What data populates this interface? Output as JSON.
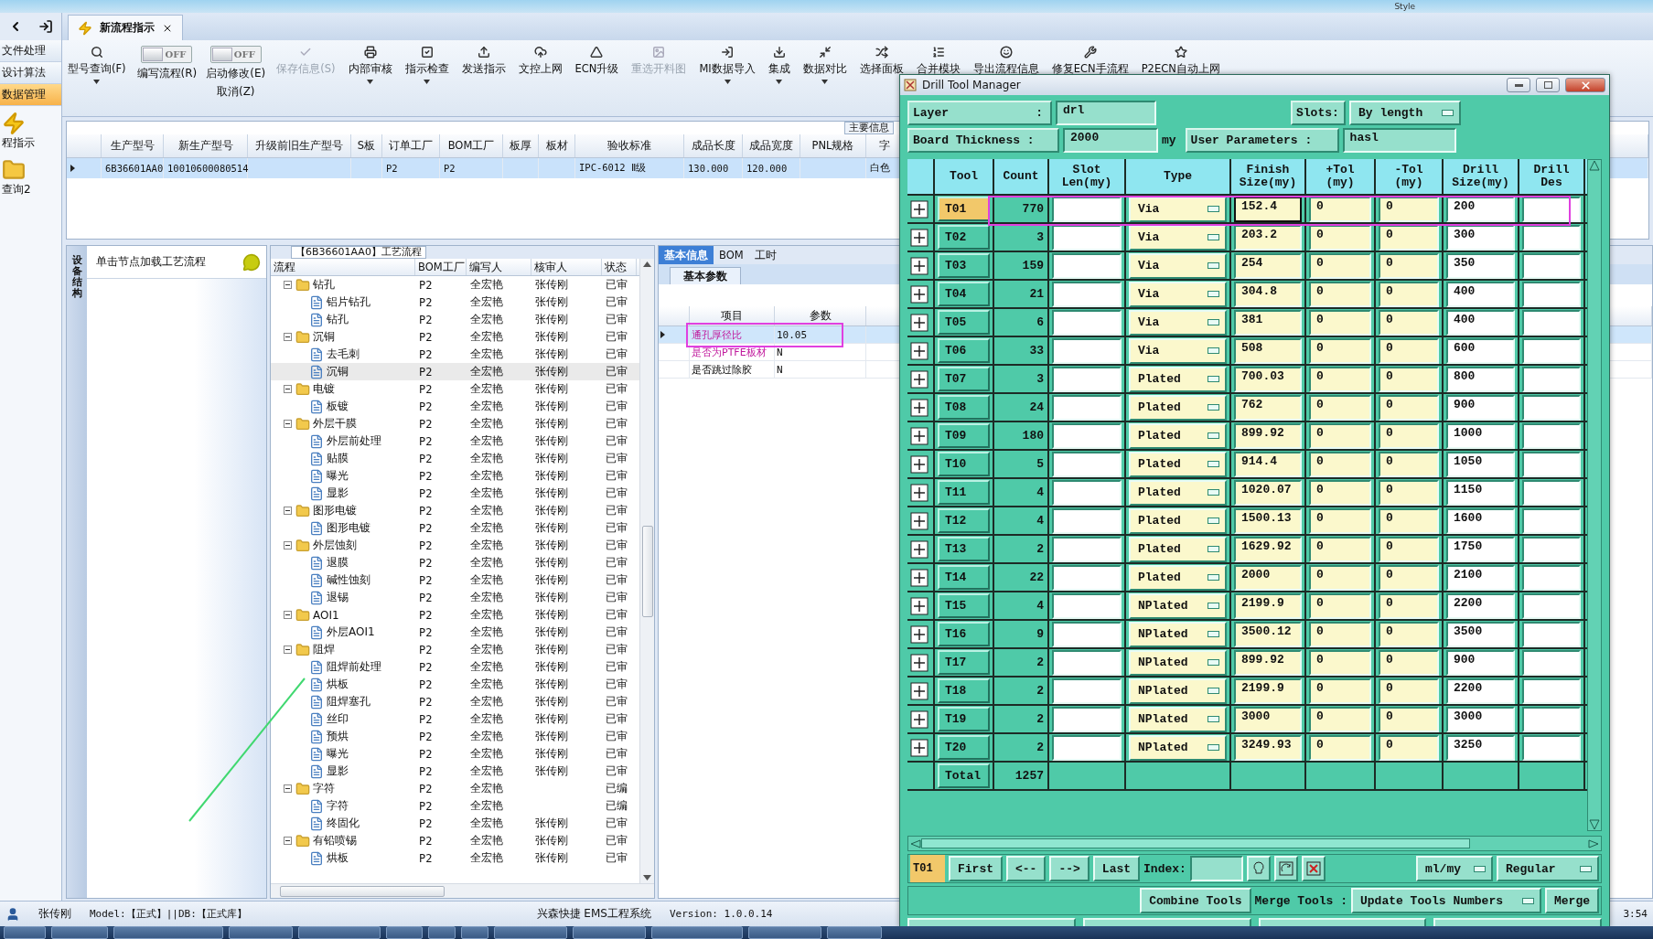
{
  "top_bar": {
    "style_menu": "Style"
  },
  "sidebar": {
    "items": [
      {
        "label": "文件处理",
        "selected": false
      },
      {
        "label": "设计算法",
        "selected": false
      },
      {
        "label": "数据管理",
        "selected": true
      }
    ],
    "shortcuts": [
      {
        "label": "程指示"
      },
      {
        "label": "查询2"
      }
    ]
  },
  "tabs": [
    {
      "label": "新流程指示",
      "selected": true
    }
  ],
  "ribbon": [
    {
      "kind": "button",
      "label": "型号查询(F)",
      "disabled": false,
      "menu": true
    },
    {
      "kind": "switch",
      "label": "编写流程(R)",
      "state": "OFF",
      "on": false
    },
    {
      "kind": "switch",
      "label": "启动修改(E)",
      "sublabel": "取消(Z)",
      "state": "OFF",
      "on": false
    },
    {
      "kind": "button",
      "label": "保存信息(S)",
      "disabled": true,
      "menu": false
    },
    {
      "kind": "button",
      "label": "内部审核",
      "disabled": false,
      "menu": true
    },
    {
      "kind": "button",
      "label": "指示检查",
      "disabled": false,
      "menu": true
    },
    {
      "kind": "button",
      "label": "发送指示",
      "disabled": false,
      "menu": false
    },
    {
      "kind": "button",
      "label": "文控上网",
      "disabled": false,
      "menu": false
    },
    {
      "kind": "button",
      "label": "ECN升级",
      "disabled": false,
      "menu": false
    },
    {
      "kind": "button",
      "label": "重选开料图",
      "disabled": true,
      "menu": false
    },
    {
      "kind": "button",
      "label": "MI数据导入",
      "disabled": false,
      "menu": true
    },
    {
      "kind": "button",
      "label": "集成",
      "disabled": false,
      "menu": true
    },
    {
      "kind": "button",
      "label": "数据对比",
      "disabled": false,
      "menu": true
    },
    {
      "kind": "button",
      "label": "选择面板",
      "disabled": false,
      "menu": false
    },
    {
      "kind": "button",
      "label": "合并模块",
      "disabled": false,
      "menu": false
    },
    {
      "kind": "button",
      "label": "导出流程信息",
      "disabled": false,
      "menu": false
    },
    {
      "kind": "button",
      "label": "修复ECN手流程",
      "disabled": false,
      "menu": false
    },
    {
      "kind": "button",
      "label": "P2ECN自动上网",
      "disabled": false,
      "menu": false
    }
  ],
  "main_table": {
    "tag": "主要信息",
    "columns": [
      "生产型号",
      "新生产型号",
      "升级前旧生产型号",
      "S板",
      "订单工厂",
      "BOM工厂",
      "板厚",
      "板材",
      "验收标准",
      "成品长度",
      "成品宽度",
      "PNL规格",
      "字"
    ],
    "rows": [
      {
        "selected": true,
        "cells": [
          "6B36601AA0",
          "10010600080514",
          "",
          "",
          "P2",
          "P2",
          "",
          "",
          "IPC-6012 Ⅱ级",
          "130.000",
          "120.000",
          "",
          "白色"
        ]
      }
    ]
  },
  "left_panel": {
    "side_tab": "设备结构",
    "hint": "单击节点加载工艺流程"
  },
  "process_tree": {
    "title": "【6B36601AA0】工艺流程",
    "columns": [
      "流程",
      "BOM工厂",
      "编写人",
      "核审人",
      "状态"
    ],
    "nodes": [
      {
        "label": "钻孔",
        "bom": "P2",
        "writer": "全宏艳",
        "reviewer": "张传刚",
        "status": "已审",
        "selected": false,
        "expanded": true,
        "children": [
          {
            "label": "铝片钻孔",
            "bom": "P2",
            "writer": "全宏艳",
            "reviewer": "张传刚",
            "status": "已审",
            "selected": false
          },
          {
            "label": "钻孔",
            "bom": "P2",
            "writer": "全宏艳",
            "reviewer": "张传刚",
            "status": "已审",
            "selected": false
          }
        ]
      },
      {
        "label": "沉铜",
        "bom": "P2",
        "writer": "全宏艳",
        "reviewer": "张传刚",
        "status": "已审",
        "selected": false,
        "expanded": true,
        "children": [
          {
            "label": "去毛刺",
            "bom": "P2",
            "writer": "全宏艳",
            "reviewer": "张传刚",
            "status": "已审",
            "selected": false
          },
          {
            "label": "沉铜",
            "bom": "P2",
            "writer": "全宏艳",
            "reviewer": "张传刚",
            "status": "已审",
            "selected": true
          }
        ]
      },
      {
        "label": "电镀",
        "bom": "P2",
        "writer": "全宏艳",
        "reviewer": "张传刚",
        "status": "已审",
        "selected": false,
        "expanded": true,
        "children": [
          {
            "label": "板镀",
            "bom": "P2",
            "writer": "全宏艳",
            "reviewer": "张传刚",
            "status": "已审",
            "selected": false
          }
        ]
      },
      {
        "label": "外层干膜",
        "bom": "P2",
        "writer": "全宏艳",
        "reviewer": "张传刚",
        "status": "已审",
        "selected": false,
        "expanded": true,
        "children": [
          {
            "label": "外层前处理",
            "bom": "P2",
            "writer": "全宏艳",
            "reviewer": "张传刚",
            "status": "已审",
            "selected": false
          },
          {
            "label": "贴膜",
            "bom": "P2",
            "writer": "全宏艳",
            "reviewer": "张传刚",
            "status": "已审",
            "selected": false
          },
          {
            "label": "曝光",
            "bom": "P2",
            "writer": "全宏艳",
            "reviewer": "张传刚",
            "status": "已审",
            "selected": false
          },
          {
            "label": "显影",
            "bom": "P2",
            "writer": "全宏艳",
            "reviewer": "张传刚",
            "status": "已审",
            "selected": false
          }
        ]
      },
      {
        "label": "图形电镀",
        "bom": "P2",
        "writer": "全宏艳",
        "reviewer": "张传刚",
        "status": "已审",
        "selected": false,
        "expanded": true,
        "children": [
          {
            "label": "图形电镀",
            "bom": "P2",
            "writer": "全宏艳",
            "reviewer": "张传刚",
            "status": "已审",
            "selected": false
          }
        ]
      },
      {
        "label": "外层蚀刻",
        "bom": "P2",
        "writer": "全宏艳",
        "reviewer": "张传刚",
        "status": "已审",
        "selected": false,
        "expanded": true,
        "children": [
          {
            "label": "退膜",
            "bom": "P2",
            "writer": "全宏艳",
            "reviewer": "张传刚",
            "status": "已审",
            "selected": false
          },
          {
            "label": "碱性蚀刻",
            "bom": "P2",
            "writer": "全宏艳",
            "reviewer": "张传刚",
            "status": "已审",
            "selected": false
          },
          {
            "label": "退锡",
            "bom": "P2",
            "writer": "全宏艳",
            "reviewer": "张传刚",
            "status": "已审",
            "selected": false
          }
        ]
      },
      {
        "label": "AOI1",
        "bom": "P2",
        "writer": "全宏艳",
        "reviewer": "张传刚",
        "status": "已审",
        "selected": false,
        "expanded": true,
        "children": [
          {
            "label": "外层AOI1",
            "bom": "P2",
            "writer": "全宏艳",
            "reviewer": "张传刚",
            "status": "已审",
            "selected": false
          }
        ]
      },
      {
        "label": "阻焊",
        "bom": "P2",
        "writer": "全宏艳",
        "reviewer": "张传刚",
        "status": "已审",
        "selected": false,
        "expanded": true,
        "children": [
          {
            "label": "阻焊前处理",
            "bom": "P2",
            "writer": "全宏艳",
            "reviewer": "张传刚",
            "status": "已审",
            "selected": false
          },
          {
            "label": "烘板",
            "bom": "P2",
            "writer": "全宏艳",
            "reviewer": "张传刚",
            "status": "已审",
            "selected": false
          },
          {
            "label": "阻焊塞孔",
            "bom": "P2",
            "writer": "全宏艳",
            "reviewer": "张传刚",
            "status": "已审",
            "selected": false
          },
          {
            "label": "丝印",
            "bom": "P2",
            "writer": "全宏艳",
            "reviewer": "张传刚",
            "status": "已审",
            "selected": false
          },
          {
            "label": "预烘",
            "bom": "P2",
            "writer": "全宏艳",
            "reviewer": "张传刚",
            "status": "已审",
            "selected": false
          },
          {
            "label": "曝光",
            "bom": "P2",
            "writer": "全宏艳",
            "reviewer": "张传刚",
            "status": "已审",
            "selected": false
          },
          {
            "label": "显影",
            "bom": "P2",
            "writer": "全宏艳",
            "reviewer": "张传刚",
            "status": "已审",
            "selected": false
          }
        ]
      },
      {
        "label": "字符",
        "bom": "P2",
        "writer": "全宏艳",
        "status": "已编",
        "selected": false,
        "expanded": true,
        "children": [
          {
            "label": "字符",
            "bom": "P2",
            "writer": "全宏艳",
            "status": "已编",
            "selected": false
          },
          {
            "label": "终固化",
            "bom": "P2",
            "writer": "全宏艳",
            "reviewer": "张传刚",
            "status": "已审",
            "selected": false
          }
        ]
      },
      {
        "label": "有铅喷锡",
        "bom": "P2",
        "writer": "全宏艳",
        "reviewer": "张传刚",
        "status": "已审",
        "selected": false,
        "expanded": true,
        "children": [
          {
            "label": "烘板",
            "bom": "P2",
            "writer": "全宏艳",
            "reviewer": "张传刚",
            "status": "已审",
            "selected": false
          }
        ]
      }
    ]
  },
  "info_panel": {
    "tabs": [
      {
        "label": "基本信息",
        "selected": true
      },
      {
        "label": "BOM",
        "selected": false
      },
      {
        "label": "工时",
        "selected": false
      }
    ],
    "subtab": "基本参数",
    "columns": [
      "项目",
      "参数"
    ],
    "rows": [
      {
        "label": "通孔厚径比",
        "value": "10.05",
        "selected": true,
        "flagged": true
      },
      {
        "label": "是否为PTFE板材",
        "value": "N",
        "selected": false,
        "flagged": true
      },
      {
        "label": "是否跳过除胶",
        "value": "N",
        "selected": false,
        "flagged": false
      }
    ]
  },
  "drill_window": {
    "title": "Drill Tool Manager",
    "layer": {
      "label": "Layer",
      "colon": ":",
      "value": "drl"
    },
    "slots": {
      "label": "Slots:",
      "value": "By length"
    },
    "thickness": {
      "label": "Board Thickness :",
      "value": "2000",
      "unit": "my"
    },
    "user_params": {
      "label": "User Parameters :",
      "value": "hasl"
    },
    "columns": [
      "Tool",
      "Count",
      "Slot Len(my)",
      "Type",
      "Finish Size(my)",
      "+Tol (my)",
      "-Tol (my)",
      "Drill Size(my)",
      "Drill Des"
    ],
    "tools": [
      {
        "tool": "T01",
        "count": "770",
        "type": "Via",
        "finish": "152.4",
        "plus_tol": "0",
        "minus_tol": "0",
        "drill_size": "200",
        "selected": true
      },
      {
        "tool": "T02",
        "count": "3",
        "type": "Via",
        "finish": "203.2",
        "plus_tol": "0",
        "minus_tol": "0",
        "drill_size": "300",
        "selected": false
      },
      {
        "tool": "T03",
        "count": "159",
        "type": "Via",
        "finish": "254",
        "plus_tol": "0",
        "minus_tol": "0",
        "drill_size": "350",
        "selected": false
      },
      {
        "tool": "T04",
        "count": "21",
        "type": "Via",
        "finish": "304.8",
        "plus_tol": "0",
        "minus_tol": "0",
        "drill_size": "400",
        "selected": false
      },
      {
        "tool": "T05",
        "count": "6",
        "type": "Via",
        "finish": "381",
        "plus_tol": "0",
        "minus_tol": "0",
        "drill_size": "400",
        "selected": false
      },
      {
        "tool": "T06",
        "count": "33",
        "type": "Via",
        "finish": "508",
        "plus_tol": "0",
        "minus_tol": "0",
        "drill_size": "600",
        "selected": false
      },
      {
        "tool": "T07",
        "count": "3",
        "type": "Plated",
        "finish": "700.03",
        "plus_tol": "0",
        "minus_tol": "0",
        "drill_size": "800",
        "selected": false
      },
      {
        "tool": "T08",
        "count": "24",
        "type": "Plated",
        "finish": "762",
        "plus_tol": "0",
        "minus_tol": "0",
        "drill_size": "900",
        "selected": false
      },
      {
        "tool": "T09",
        "count": "180",
        "type": "Plated",
        "finish": "899.92",
        "plus_tol": "0",
        "minus_tol": "0",
        "drill_size": "1000",
        "selected": false
      },
      {
        "tool": "T10",
        "count": "5",
        "type": "Plated",
        "finish": "914.4",
        "plus_tol": "0",
        "minus_tol": "0",
        "drill_size": "1050",
        "selected": false
      },
      {
        "tool": "T11",
        "count": "4",
        "type": "Plated",
        "finish": "1020.07",
        "plus_tol": "0",
        "minus_tol": "0",
        "drill_size": "1150",
        "selected": false
      },
      {
        "tool": "T12",
        "count": "4",
        "type": "Plated",
        "finish": "1500.13",
        "plus_tol": "0",
        "minus_tol": "0",
        "drill_size": "1600",
        "selected": false
      },
      {
        "tool": "T13",
        "count": "2",
        "type": "Plated",
        "finish": "1629.92",
        "plus_tol": "0",
        "minus_tol": "0",
        "drill_size": "1750",
        "selected": false
      },
      {
        "tool": "T14",
        "count": "22",
        "type": "Plated",
        "finish": "2000",
        "plus_tol": "0",
        "minus_tol": "0",
        "drill_size": "2100",
        "selected": false
      },
      {
        "tool": "T15",
        "count": "4",
        "type": "NPlated",
        "finish": "2199.9",
        "plus_tol": "0",
        "minus_tol": "0",
        "drill_size": "2200",
        "selected": false
      },
      {
        "tool": "T16",
        "count": "9",
        "type": "NPlated",
        "finish": "3500.12",
        "plus_tol": "0",
        "minus_tol": "0",
        "drill_size": "3500",
        "selected": false
      },
      {
        "tool": "T17",
        "count": "2",
        "type": "NPlated",
        "finish": "899.92",
        "plus_tol": "0",
        "minus_tol": "0",
        "drill_size": "900",
        "selected": false
      },
      {
        "tool": "T18",
        "count": "2",
        "type": "NPlated",
        "finish": "2199.9",
        "plus_tol": "0",
        "minus_tol": "0",
        "drill_size": "2200",
        "selected": false
      },
      {
        "tool": "T19",
        "count": "2",
        "type": "NPlated",
        "finish": "3000",
        "plus_tol": "0",
        "minus_tol": "0",
        "drill_size": "3000",
        "selected": false
      },
      {
        "tool": "T20",
        "count": "2",
        "type": "NPlated",
        "finish": "3249.93",
        "plus_tol": "0",
        "minus_tol": "0",
        "drill_size": "3250",
        "selected": false
      }
    ],
    "total": {
      "label": "Total",
      "count": "1257"
    },
    "nav": {
      "current": "T01",
      "buttons": [
        "First",
        "<--",
        "-->",
        "Last"
      ],
      "index_label": "Index:",
      "units": "ml/my",
      "mode": "Regular"
    },
    "merge": {
      "combine": "Combine Tools",
      "merge_label": "Merge Tools :",
      "numbers": "Update Tools Numbers",
      "merge": "Merge"
    }
  },
  "status_bar": {
    "user": "张传刚",
    "model_db": "Model:【正式】||DB:【正式库】",
    "product": "兴森快捷 EMS工程系统",
    "version": "Version: 1.0.0.14",
    "time": "3:54"
  }
}
